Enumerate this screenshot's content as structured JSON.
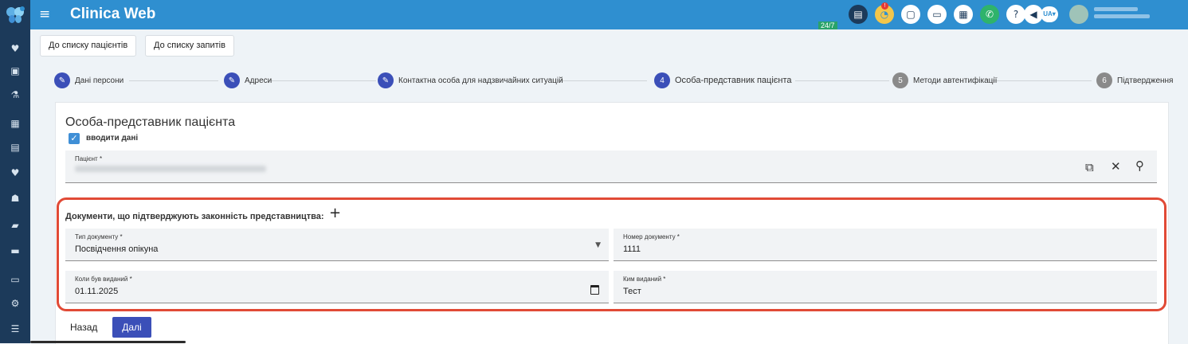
{
  "app": {
    "title": "Clinica Web",
    "menu_icon": "hamburger-icon",
    "logo_icon": "butterfly-logo-icon"
  },
  "topbar": {
    "badge_247": "24/7",
    "notification_count": "!",
    "language": "UA▾",
    "icons": [
      "chat-icon",
      "stats-icon",
      "pdf-icon",
      "card-icon",
      "calculator-icon",
      "phone-icon",
      "help-icon",
      "megaphone-icon"
    ]
  },
  "sidebar": {
    "icons": [
      "heart-icon",
      "book-icon",
      "flask-icon",
      "calendar-icon",
      "document-icon",
      "heartbeat-icon",
      "users-icon",
      "notebook-icon",
      "folder-icon",
      "money-icon",
      "settings-icon",
      "list-icon"
    ]
  },
  "nav": {
    "back_to_patients": "До списку пацієнтів",
    "back_to_requests": "До списку запитів"
  },
  "stepper": {
    "steps": [
      {
        "label": "Дані персони",
        "number": "",
        "state": "done"
      },
      {
        "label": "Адреси",
        "number": "",
        "state": "done"
      },
      {
        "label": "Контактна особа для надзвичайних ситуацій",
        "number": "",
        "state": "done"
      },
      {
        "label": "Особа-представник пацієнта",
        "number": "4",
        "state": "active"
      },
      {
        "label": "Методи автентифікації",
        "number": "5",
        "state": "future"
      },
      {
        "label": "Підтвердження",
        "number": "6",
        "state": "future"
      }
    ]
  },
  "section": {
    "title": "Особа-представник пацієнта",
    "checkbox_label": "вводити дані",
    "checkbox_checked": true,
    "patient_field_label": "Пацієнт *"
  },
  "documents": {
    "title": "Документи, що підтверджують законність представництва:",
    "doc_type_label": "Тип документу *",
    "doc_type_value": "Посвідчення опікуна",
    "doc_number_label": "Номер документу *",
    "doc_number_value": "1111",
    "issued_date_label": "Коли був виданий *",
    "issued_date_value": "01.11.2025",
    "issued_by_label": "Ким виданий *",
    "issued_by_value": "Тест"
  },
  "actions": {
    "back": "Назад",
    "next": "Далі"
  },
  "colors": {
    "topbar": "#2f8fd0",
    "sidebar": "#1c3a5a",
    "primary": "#3b4fb8",
    "highlight": "#e14a36"
  }
}
